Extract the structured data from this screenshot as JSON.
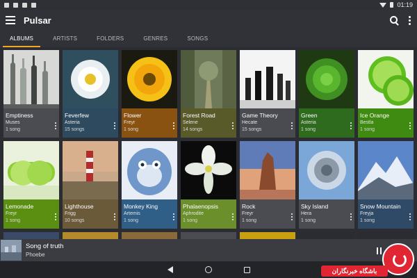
{
  "status_bar": {
    "time": "01:19"
  },
  "app": {
    "title": "Pulsar"
  },
  "tabs": [
    {
      "label": "ALBUMS",
      "active": true
    },
    {
      "label": "ARTISTS",
      "active": false
    },
    {
      "label": "FOLDERS",
      "active": false
    },
    {
      "label": "GENRES",
      "active": false
    },
    {
      "label": "SONGS",
      "active": false
    }
  ],
  "albums": [
    {
      "title": "Emptiness",
      "artist": "Muses",
      "count": "1 song",
      "color": "#4a4c52",
      "icon": "bottles-art"
    },
    {
      "title": "Feverfew",
      "artist": "Asteria",
      "count": "15 songs",
      "color": "#2e4a5e",
      "icon": "daisy-art"
    },
    {
      "title": "Flower",
      "artist": "Freyr",
      "count": "1 song",
      "color": "#8a5210",
      "icon": "sunflower-art"
    },
    {
      "title": "Forest Road",
      "artist": "Selene",
      "count": "14 songs",
      "color": "#595a2a",
      "icon": "forest-art"
    },
    {
      "title": "Game Theory",
      "artist": "Hecate",
      "count": "15 songs",
      "color": "#4a4b50",
      "icon": "chess-art"
    },
    {
      "title": "Green",
      "artist": "Asteria",
      "count": "1 song",
      "color": "#2f6b1f",
      "icon": "succulent-art"
    },
    {
      "title": "Ice Orange",
      "artist": "Bestla",
      "count": "1 song",
      "color": "#3f8a10",
      "icon": "lime-art"
    },
    {
      "title": "Lemonade",
      "artist": "Freyr",
      "count": "1 song",
      "color": "#5b8f12",
      "icon": "lemonade-art"
    },
    {
      "title": "Lighthouse",
      "artist": "Frigg",
      "count": "10 songs",
      "color": "#6b5a3a",
      "icon": "lighthouse-art"
    },
    {
      "title": "Monkey King",
      "artist": "Artemis",
      "count": "1 song",
      "color": "#2f5f86",
      "icon": "monkey-art"
    },
    {
      "title": "Phalaenopsis",
      "artist": "Aphrodite",
      "count": "1 song",
      "color": "#6b8f2a",
      "icon": "orchid-art"
    },
    {
      "title": "Rock",
      "artist": "Freyr",
      "count": "1 song",
      "color": "#4a4c52",
      "icon": "rock-art"
    },
    {
      "title": "Sky Island",
      "artist": "Hera",
      "count": "1 song",
      "color": "#4a4c52",
      "icon": "sky-island-art"
    },
    {
      "title": "Snow Mountain",
      "artist": "Freyja",
      "count": "1 song",
      "color": "#2f4a66",
      "icon": "mountain-art"
    }
  ],
  "now_playing": {
    "title": "Song of truth",
    "artist": "Phoebe"
  },
  "watermark": {
    "text": "باشگاه خبرنگاران"
  }
}
